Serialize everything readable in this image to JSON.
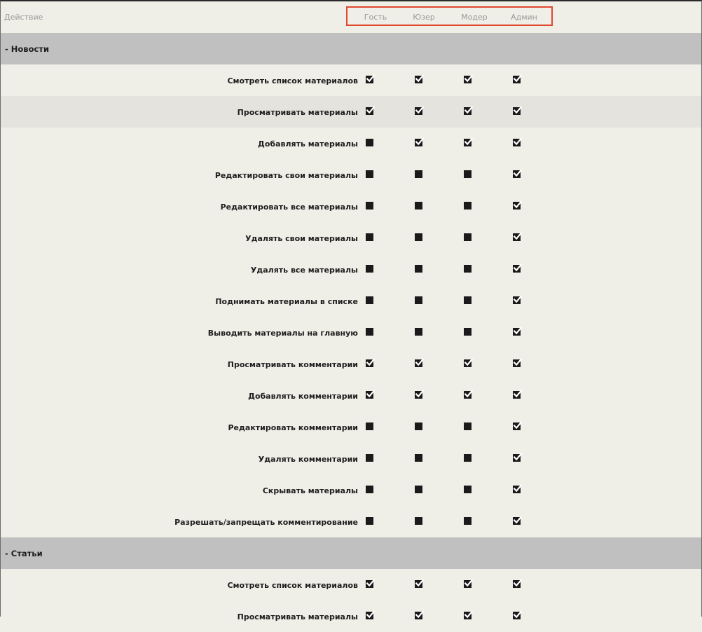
{
  "header": {
    "action_label": "Действие",
    "roles": [
      "Гость",
      "Юзер",
      "Модер",
      "Админ"
    ]
  },
  "sections": [
    {
      "title": "- Новости",
      "rows": [
        {
          "label": "Смотреть список материалов",
          "checks": [
            true,
            true,
            true,
            true
          ]
        },
        {
          "label": "Просматривать материалы",
          "checks": [
            true,
            true,
            true,
            true
          ]
        },
        {
          "label": "Добавлять материалы",
          "checks": [
            false,
            true,
            true,
            true
          ]
        },
        {
          "label": "Редактировать свои материалы",
          "checks": [
            false,
            false,
            false,
            true
          ]
        },
        {
          "label": "Редактировать все материалы",
          "checks": [
            false,
            false,
            false,
            true
          ]
        },
        {
          "label": "Удалять свои материалы",
          "checks": [
            false,
            false,
            false,
            true
          ]
        },
        {
          "label": "Удалять все материалы",
          "checks": [
            false,
            false,
            false,
            true
          ]
        },
        {
          "label": "Поднимать материалы в списке",
          "checks": [
            false,
            false,
            false,
            true
          ]
        },
        {
          "label": "Выводить материалы на главную",
          "checks": [
            false,
            false,
            false,
            true
          ]
        },
        {
          "label": "Просматривать комментарии",
          "checks": [
            true,
            true,
            true,
            true
          ]
        },
        {
          "label": "Добавлять комментарии",
          "checks": [
            true,
            true,
            true,
            true
          ]
        },
        {
          "label": "Редактировать комментарии",
          "checks": [
            false,
            false,
            false,
            true
          ]
        },
        {
          "label": "Удалять комментарии",
          "checks": [
            false,
            false,
            false,
            true
          ]
        },
        {
          "label": "Скрывать материалы",
          "checks": [
            false,
            false,
            false,
            true
          ]
        },
        {
          "label": "Разрешать/запрещать комментирование",
          "checks": [
            false,
            false,
            false,
            true
          ]
        }
      ]
    },
    {
      "title": "- Статьи",
      "rows": [
        {
          "label": "Смотреть список материалов",
          "checks": [
            true,
            true,
            true,
            true
          ]
        },
        {
          "label": "Просматривать материалы",
          "checks": [
            true,
            true,
            true,
            true
          ]
        }
      ]
    }
  ],
  "highlight_row": {
    "section": 0,
    "row": 1
  },
  "colors": {
    "accent_box": "#e0482e",
    "section_bg": "#c0c0c0",
    "page_bg": "#efeee7",
    "highlight_bg": "#e4e3de"
  }
}
